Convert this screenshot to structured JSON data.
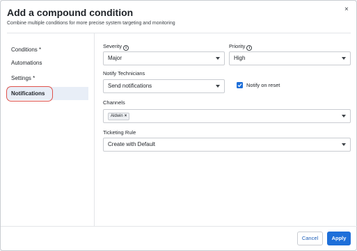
{
  "dialog": {
    "title": "Add a compound condition",
    "subtitle": "Combine multiple conditions for more precise system targeting and monitoring",
    "close_glyph": "×"
  },
  "sidebar": {
    "items": [
      {
        "label": "Conditions *",
        "active": false
      },
      {
        "label": "Automations",
        "active": false
      },
      {
        "label": "Settings *",
        "active": false
      },
      {
        "label": "Notifications",
        "active": true
      }
    ]
  },
  "form": {
    "severity": {
      "label": "Severity",
      "info_glyph": "i",
      "value": "Major"
    },
    "priority": {
      "label": "Priority",
      "info_glyph": "i",
      "value": "High"
    },
    "notify_technicians": {
      "label": "Notify Technicians",
      "value": "Send notifications"
    },
    "notify_on_reset": {
      "label": "Notify on reset",
      "checked": true
    },
    "channels": {
      "label": "Channels",
      "tags": [
        {
          "label": "Aldwin",
          "remove_glyph": "×"
        }
      ]
    },
    "ticketing_rule": {
      "label": "Ticketing Rule",
      "value": "Create with Default"
    }
  },
  "footer": {
    "cancel_label": "Cancel",
    "apply_label": "Apply"
  },
  "colors": {
    "accent": "#1e6fd9",
    "highlight_ring": "#e0524b",
    "active_item_bg": "#e8eef7"
  }
}
